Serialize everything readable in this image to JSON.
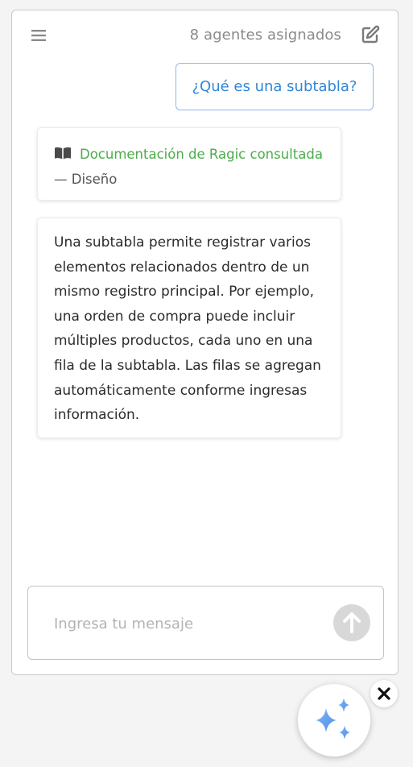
{
  "header": {
    "agents_count": "8 agentes asignados",
    "menu_icon": "hamburger-menu-icon",
    "edit_icon": "edit-icon"
  },
  "conversation": {
    "user_message": "¿Qué es una subtabla?",
    "source_card": {
      "icon": "book-icon",
      "link_text": "Documentación de Ragic consultada",
      "separator": "—",
      "section": "Diseño"
    },
    "answer": "Una subtabla permite registrar varios elementos relacionados dentro de un mismo registro principal. Por ejemplo, una orden de compra puede incluir múltiples productos, cada uno en una fila de la subtabla. Las filas se agregan automáticamente conforme ingresas información."
  },
  "composer": {
    "placeholder": "Ingresa tu mensaje",
    "send_icon": "arrow-up-icon"
  },
  "launcher": {
    "fab_icon": "sparkles-icon",
    "close_icon": "close-icon"
  },
  "colors": {
    "accent_blue": "#2f86d8",
    "link_green": "#4aad4a",
    "sparkle_blue": "#5b9ff0"
  }
}
